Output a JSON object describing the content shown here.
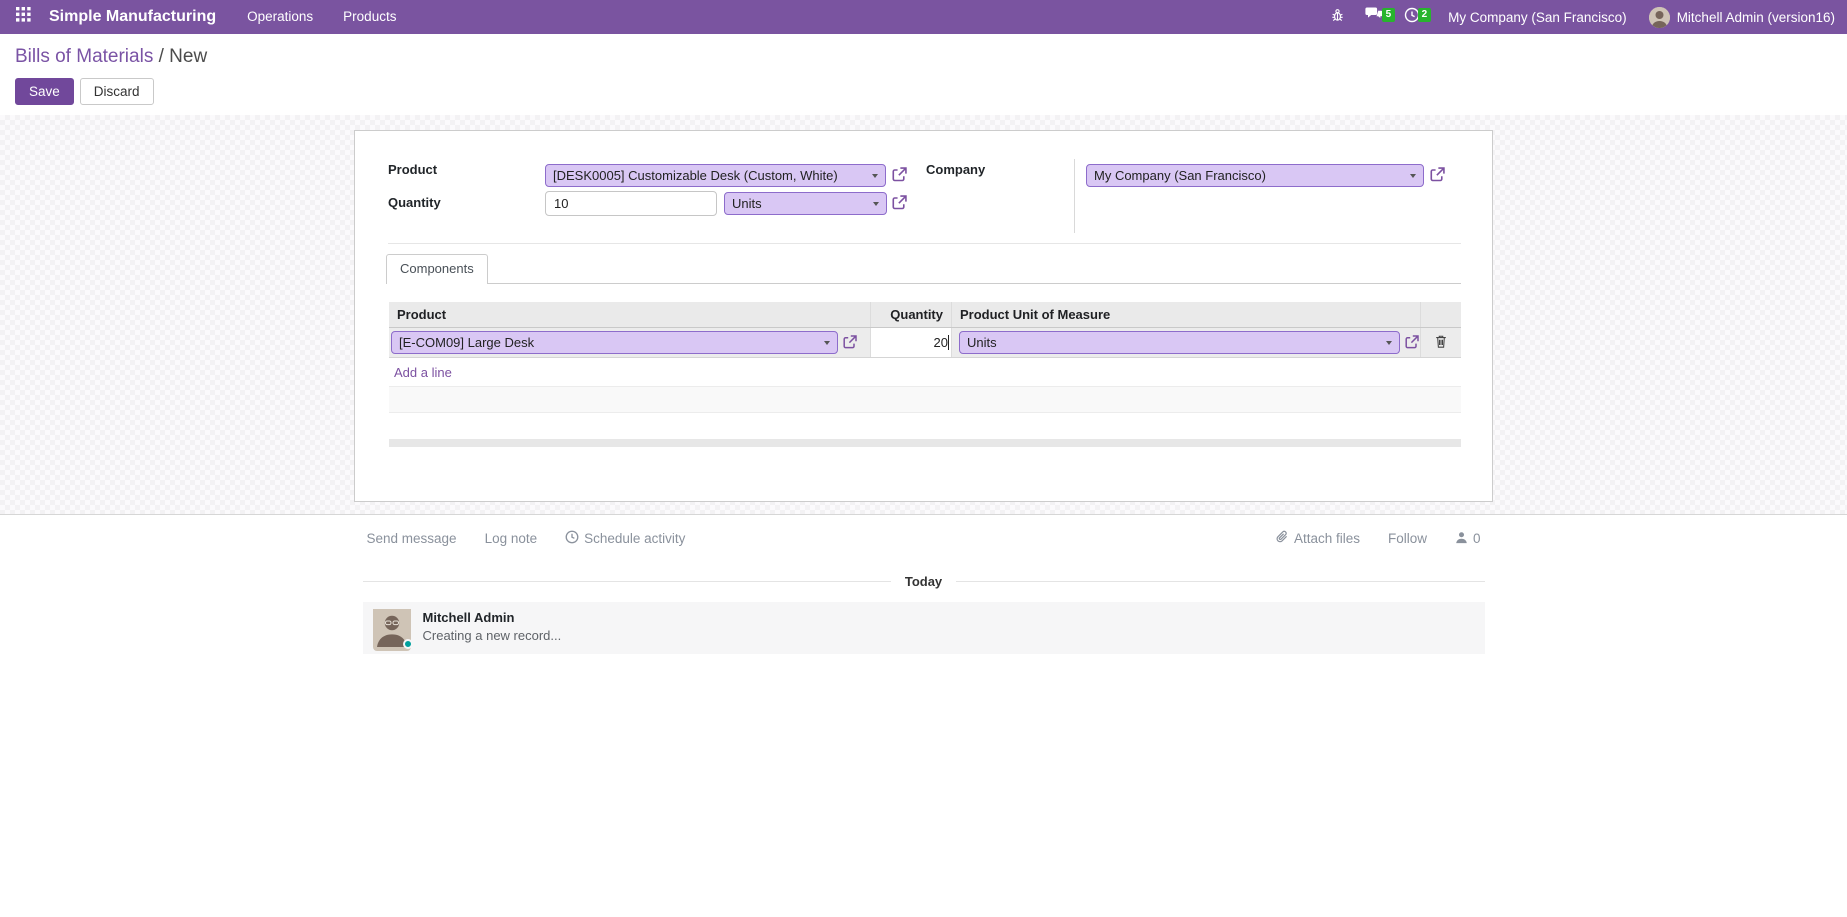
{
  "nav": {
    "app_name": "Simple Manufacturing",
    "menus": [
      {
        "label": "Operations"
      },
      {
        "label": "Products"
      }
    ],
    "message_badge": "5",
    "activity_badge": "2",
    "company": "My Company (San Francisco)",
    "user": "Mitchell Admin (version16)"
  },
  "breadcrumb": {
    "parent": "Bills of Materials",
    "separator": " / ",
    "current": "New"
  },
  "actions": {
    "save": "Save",
    "discard": "Discard"
  },
  "form": {
    "product": {
      "label": "Product",
      "value": "[DESK0005] Customizable Desk (Custom, White)"
    },
    "quantity": {
      "label": "Quantity",
      "value": "10",
      "uom": "Units"
    },
    "company": {
      "label": "Company",
      "value": "My Company (San Francisco)"
    }
  },
  "notebook": {
    "tabs": [
      {
        "label": "Components"
      }
    ]
  },
  "components_table": {
    "headers": {
      "product": "Product",
      "quantity": "Quantity",
      "uom": "Product Unit of Measure"
    },
    "rows": [
      {
        "product": "[E-COM09] Large Desk",
        "quantity": "20",
        "uom": "Units"
      }
    ],
    "add_line": "Add a line"
  },
  "chatter": {
    "send_message": "Send message",
    "log_note": "Log note",
    "schedule_activity": "Schedule activity",
    "attach_files": "Attach files",
    "follow": "Follow",
    "follower_count": "0",
    "date_group": "Today",
    "messages": [
      {
        "author": "Mitchell Admin",
        "body": "Creating a new record..."
      }
    ]
  },
  "colors": {
    "navbar": "#7a54a0",
    "badge_green": "#28b42e",
    "field_background": "#d9c7f4",
    "field_border": "#8d6ccb",
    "link_purple": "#7c51a1",
    "save_button": "#71489b",
    "online_status": "#00a09d"
  }
}
